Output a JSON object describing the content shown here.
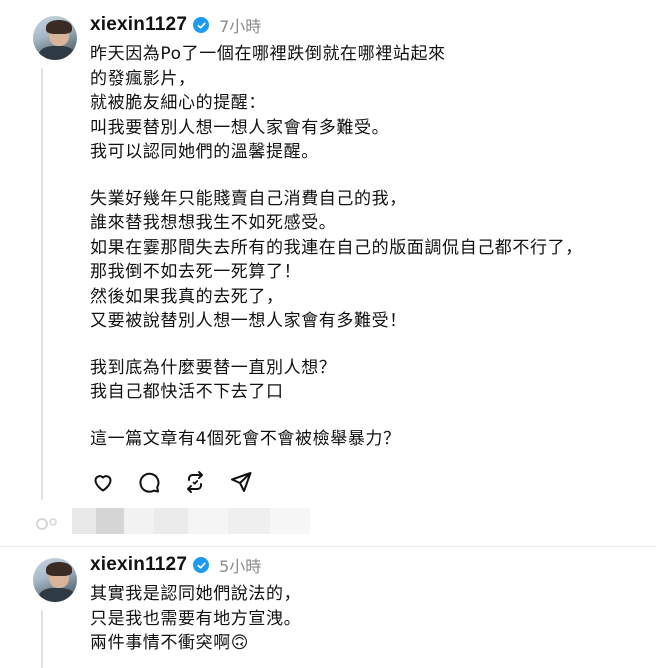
{
  "post1": {
    "username": "xiexin1127",
    "time": "7小時",
    "paragraphs": [
      [
        "昨天因為Po了一個在哪裡跌倒就在哪裡站起來",
        "的發瘋影片，",
        "就被脆友細心的提醒：",
        "叫我要替別人想一想人家會有多難受。",
        "我可以認同她們的溫馨提醒。"
      ],
      [
        "失業好幾年只能賤賣自己消費自己的我，",
        "誰來替我想想我生不如死感受。",
        "如果在霎那間失去所有的我連在自己的版面調侃自己都不行了，",
        "那我倒不如去死一死算了！",
        "然後如果我真的去死了，",
        "又要被說替別人想一想人家會有多難受！"
      ],
      [
        "我到底為什麼要替一直別人想？",
        "我自己都快活不下去了口"
      ],
      [
        "這一篇文章有4個死會不會被檢舉暴力？"
      ]
    ],
    "actions": [
      "heart-icon",
      "comment-icon",
      "repost-icon",
      "share-icon"
    ]
  },
  "post2": {
    "username": "xiexin1127",
    "time": "5小時",
    "lines": [
      "其實我是認同她們說法的，",
      "只是我也需要有地方宣洩。",
      "兩件事情不衝突啊🙃"
    ]
  },
  "colors": {
    "verified": "#1d9bf0",
    "muted": "#8a8a8a",
    "text": "#111111"
  }
}
